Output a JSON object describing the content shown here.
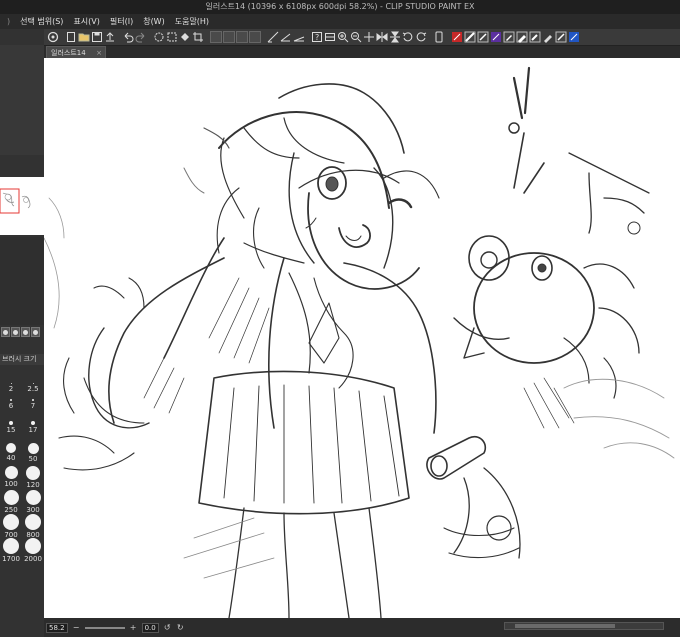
{
  "window": {
    "title": "일러스트14 (10396 x 6108px 600dpi 58.2%) - CLIP STUDIO PAINT EX"
  },
  "menu": {
    "items": [
      "선택 범위(S)",
      "표시(V)",
      "필터(I)",
      "창(W)",
      "도움말(H)"
    ]
  },
  "document_tab": {
    "label": "일러스트14",
    "close": "×"
  },
  "brush_size_panel": {
    "title": "브러시 크기",
    "sizes": [
      "2",
      "2.5",
      "6",
      "7",
      "15",
      "17",
      "40",
      "50",
      "100",
      "120",
      "250",
      "300",
      "700",
      "800",
      "1700",
      "2000"
    ]
  },
  "status_bar": {
    "zoom": "58.2",
    "rotation": "0.0"
  },
  "colors": {
    "chrome_dark": "#2b2b2b",
    "toolbar": "#3a3a3a",
    "canvas": "#ffffff",
    "accent_red": "#c62828",
    "accent_purple": "#5b2fa0",
    "accent_blue": "#2156c4"
  },
  "toolbar_icons": [
    "new-icon",
    "open-icon",
    "save-icon",
    "undo-icon",
    "redo-icon",
    "clear-icon",
    "fill-icon",
    "crop-icon",
    "ruler-icon",
    "zoom-in-icon",
    "zoom-out-icon",
    "rotate-icon",
    "flip-icon",
    "color-swatch-icon",
    "brush-icon",
    "pen-icon"
  ]
}
